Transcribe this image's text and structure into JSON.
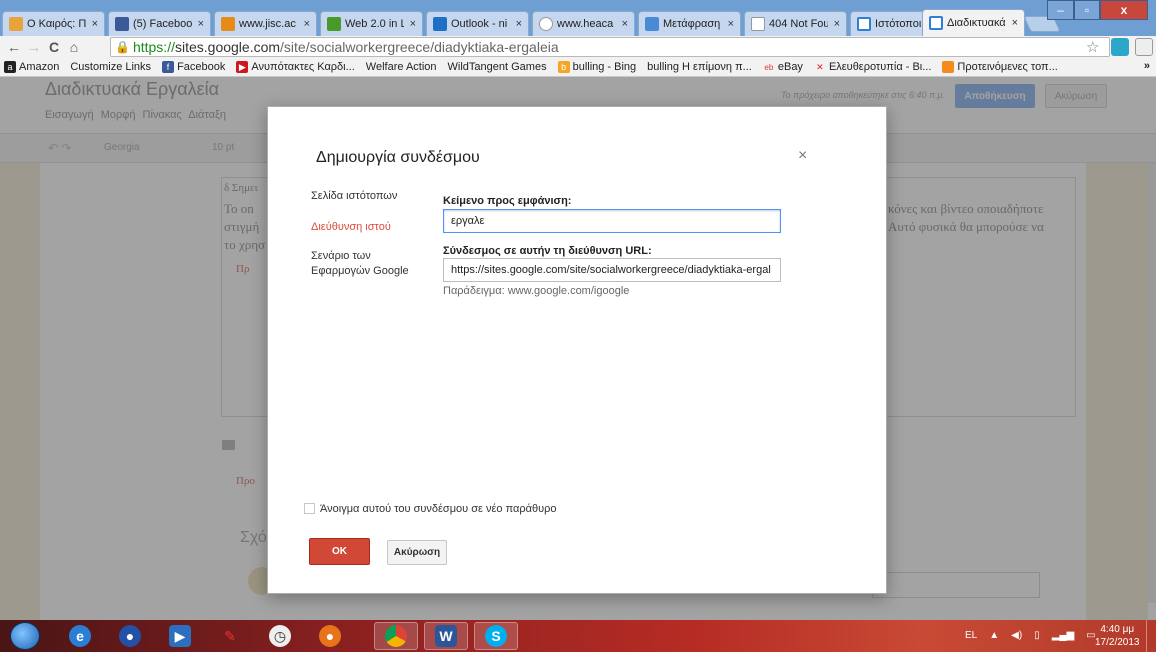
{
  "browser": {
    "tabs": [
      {
        "label": "Ο Καιρός: Π",
        "color": "#e8a33a"
      },
      {
        "label": "(5) Faceboo",
        "color": "#3b5998"
      },
      {
        "label": "www.jisc.ac",
        "color": "#e88a1a"
      },
      {
        "label": "Web 2.0 in L",
        "color": "#4a9a2a"
      },
      {
        "label": "Outlook - ni",
        "color": "#1f6fc5"
      },
      {
        "label": "www.heaca",
        "color": "#ffffff"
      },
      {
        "label": "Μετάφραση",
        "color": "#4b8bd6"
      },
      {
        "label": "404 Not Fou",
        "color": "#ffffff"
      },
      {
        "label": "Ιστότοποι G",
        "color": "#2f7fd6"
      },
      {
        "label": "Διαδικτυακά",
        "color": "#2f7fd6"
      }
    ],
    "tab_close": "×",
    "window": {
      "minimize": "–",
      "maximize": "▫",
      "close": "x"
    },
    "nav": {
      "back": "←",
      "forward": "→",
      "reload": "C",
      "home": "⌂"
    },
    "address": {
      "scheme": "https://",
      "host": "sites.google.com",
      "path": "/site/socialworkergreece/diadyktiaka-ergaleia"
    },
    "bookmarks": [
      {
        "label": "Amazon",
        "icon": "amazon-icon",
        "color": "#222"
      },
      {
        "label": "Customize Links",
        "icon": "page-icon",
        "color": ""
      },
      {
        "label": "Facebook",
        "icon": "facebook-icon",
        "color": "#3b5998"
      },
      {
        "label": "Ανυπότακτες Καρδι...",
        "icon": "youtube-icon",
        "color": "#cc181e"
      },
      {
        "label": "Welfare Action",
        "icon": "page-icon",
        "color": ""
      },
      {
        "label": "WildTangent Games",
        "icon": "page-icon",
        "color": ""
      },
      {
        "label": "bulling - Bing",
        "icon": "bing-icon",
        "color": "#f5a623"
      },
      {
        "label": "bulling Η επίμονη π...",
        "icon": "page-icon",
        "color": ""
      },
      {
        "label": "eBay",
        "icon": "ebay-icon",
        "color": "#e53238"
      },
      {
        "label": "Ελευθεροτυπία - Βι...",
        "icon": "enet-icon",
        "color": "#e02020"
      },
      {
        "label": "Προτεινόμενες τοπ...",
        "icon": "suggested-icon",
        "color": "#f58a1f"
      }
    ],
    "bookmarks_more": "»"
  },
  "page": {
    "site_title": "Διαδικτυακά Εργαλεία",
    "menus": "Εισαγωγή Μορφή Πίνακας Διάταξη",
    "draft_status": "Το πρόχειρο αποθηκεύτηκε στις 6:40 π.μ.",
    "save": "Αποθήκευση",
    "cancel": "Ακύρωση",
    "font": "Georgia",
    "font_size": "10 pt",
    "body_text": {
      "l1": "δ Σημει",
      "l2": "Το οn",
      "l3": "στιγμή",
      "l4": "το χρησ",
      "r1": "κόνες και βίντεο οποιαδήποτε",
      "r2": "Αυτό φυσικά θα μπορούσε να"
    },
    "add_link1": "Πρ",
    "add_link2": "Προ",
    "comments_heading": "Σχόλ"
  },
  "dialog": {
    "title": "Δημιουργία συνδέσμου",
    "close": "×",
    "nav": [
      "Σελίδα ιστότοπων",
      "Διεύθυνση ιστού",
      "Σενάριο των Εφαρμογών Google"
    ],
    "text_label": "Κείμενο προς εμφάνιση:",
    "text_value": "εργαλε",
    "url_label": "Σύνδεσμος σε αυτήν τη διεύθυνση URL:",
    "url_value": "https://sites.google.com/site/socialworkergreece/diadyktiaka-ergal",
    "example": "Παράδειγμα: www.google.com/igoogle",
    "new_window_label": "Άνοιγμα αυτού του συνδέσμου σε νέο παράθυρο",
    "ok": "ΟΚ",
    "cancel": "Ακύρωση"
  },
  "taskbar": {
    "language": "EL",
    "tray_up": "▲",
    "time": "4:40 μμ",
    "date": "17/2/2013"
  }
}
